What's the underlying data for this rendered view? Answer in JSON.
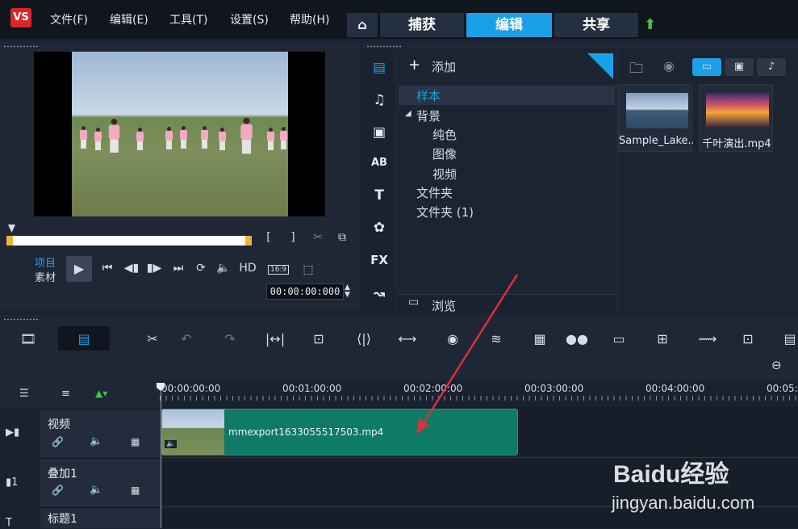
{
  "menubar": {
    "logo_text": "VS",
    "items": [
      "文件(F)",
      "编辑(E)",
      "工具(T)",
      "设置(S)",
      "帮助(H)"
    ],
    "home_icon": "home-icon",
    "tabs": [
      "捕获",
      "编辑",
      "共享"
    ],
    "active_tab": "编辑",
    "upload_icon": "upload-arrow-icon"
  },
  "preview": {
    "mode_project": "项目",
    "mode_clip": "素材",
    "hd_label": "HD",
    "aspect_label": "16:9",
    "timecode": "00:00:00:000",
    "mark_in": "[",
    "mark_out": "]"
  },
  "library": {
    "add_label": "添加",
    "tree": {
      "samples": "样本",
      "background": "背景",
      "solid_color": "纯色",
      "image": "图像",
      "video": "视频",
      "folder": "文件夹",
      "folder_count": "文件夹 (1)"
    },
    "browse_label": "浏览",
    "sidebar_labels": {
      "title_ab": "AB",
      "text_t": "T",
      "fx": "FX"
    },
    "thumbnails": [
      {
        "name": "Sample_Lake..."
      },
      {
        "name": "千叶演出.mp4"
      }
    ]
  },
  "timeline": {
    "ruler_labels": [
      "00:00:00:00",
      "00:01:00:00",
      "00:02:00:00",
      "00:03:00:00",
      "00:04:00:00",
      "00:05:"
    ],
    "tracks": [
      {
        "name": "视频"
      },
      {
        "name": "叠加1"
      },
      {
        "name": "标题1"
      }
    ],
    "clip_name": "mmexport1633055517503.mp4"
  },
  "watermark": {
    "brand": "Baidu经验",
    "url": "jingyan.baidu.com"
  },
  "colors": {
    "accent_tab": "#1aa0e6",
    "clip": "#0f7a65",
    "arrow": "#d8323a"
  }
}
